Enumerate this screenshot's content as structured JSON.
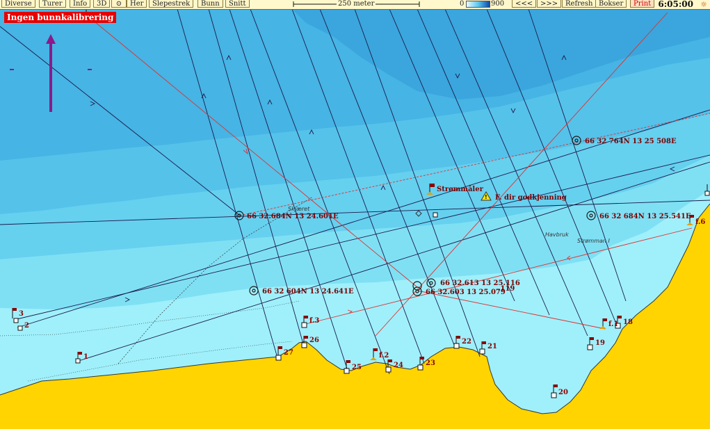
{
  "toolbar": {
    "diverse": "Diverse",
    "turer": "Turer",
    "info": "Info",
    "three_d": "3D",
    "her": "Her",
    "slepestrek": "Slepestrek",
    "bunn": "Bunn",
    "snitt": "Snitt",
    "scale_label": "250 meter",
    "depth_min": "0",
    "depth_max": "900",
    "back": "<<<",
    "forward": ">>>",
    "refresh": "Refresh",
    "bokser": "Bokser",
    "print": "Print",
    "clock": "6:05:00"
  },
  "warning": "Ingen bunnkalibrering",
  "map": {
    "labels": {
      "p1": "66 32 764N 13 25 508E",
      "p2": "66 32.684N 13 24.601E",
      "p3": "66 32 684N 13 25.541E",
      "p4": "66 32 604N 13 24.641E",
      "p5": "66 32.613 13 25.116",
      "p6": "66 32.603 13 25.079",
      "p7": ".119",
      "strommaler": "Strømmåler",
      "godkjenning": "F. dir godkjenning",
      "havbruk": "Havbruk",
      "stromman": "Strømman I",
      "skjaer": "Skjæret"
    },
    "stations": [
      "1",
      "2",
      "3",
      "20",
      "21",
      "22",
      "23",
      "24",
      "25",
      "26",
      "27",
      "19",
      "18",
      "f.1",
      "f.2",
      "f.3",
      "f.6"
    ],
    "colors": {
      "land": "#ffd400",
      "deep": "#3fb6e6",
      "shallow": "#9ff0fb",
      "track_red": "#e03030",
      "track_dark": "#1a1a4a",
      "marker": "#8b0000"
    }
  }
}
